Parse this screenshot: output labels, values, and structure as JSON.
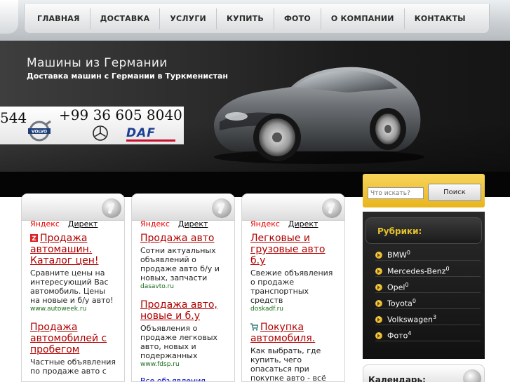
{
  "nav": {
    "items": [
      "ГЛАВНАЯ",
      "ДОСТАВКА",
      "УСЛУГИ",
      "КУПИТЬ",
      "ФОТО",
      "О КОМПАНИИ",
      "КОНТАКТЫ"
    ]
  },
  "header": {
    "title": "Машины из Германии",
    "subtitle": "Доставка машин с Германии в Туркменистан",
    "phone_left": "544",
    "phone_main": "+99 36 605 8040",
    "brand_daf": "DAF"
  },
  "columns": [
    {
      "yandex": "Яндекс",
      "direct": "Директ",
      "ads": [
        {
          "title": "Продажа автомашин. Каталог цен!",
          "text": "Сравните цены на интересующий Вас автомобиль. Цены на новые и б/у авто!",
          "url": "www.autoweek.ru"
        },
        {
          "title": "Продажа автомобилей с пробегом",
          "text": "Частные объявления по продаже авто с",
          "url": ""
        }
      ]
    },
    {
      "yandex": "Яндекс",
      "direct": "Директ",
      "ads": [
        {
          "title": "Продажа авто",
          "text": "Сотни актуальных объявлений о продаже авто б/у и новых, запчасти",
          "url": "dasavto.ru"
        },
        {
          "title": "Продажа авто, новые и б.у",
          "text": "Объявления о продаже легковых авто, новых и подержанных",
          "url": "www.fdsp.ru"
        }
      ],
      "all_link": "Все объявления"
    },
    {
      "yandex": "Яндекс",
      "direct": "Директ",
      "ads": [
        {
          "title": "Легковые и грузовые авто б.у",
          "text": "Свежие объявления о продаже транспортных средств",
          "url": "doskadf.ru"
        },
        {
          "title": "Покупка автомобиля.",
          "text": "Как выбрать, где купить, чего опасаться при покупке авто - всё",
          "url": ""
        }
      ]
    }
  ],
  "search": {
    "placeholder": "Что искать?",
    "button": "Поиск"
  },
  "rubrics": {
    "title": "Рубрики:",
    "items": [
      {
        "label": "BMW",
        "count": "0"
      },
      {
        "label": "Mercedes-Benz",
        "count": "0"
      },
      {
        "label": "Opel",
        "count": "0"
      },
      {
        "label": "Toyota",
        "count": "0"
      },
      {
        "label": "Volkswagen",
        "count": "3"
      },
      {
        "label": "Фото",
        "count": "4"
      }
    ]
  },
  "calendar": {
    "title": "Календарь:"
  },
  "colors": {
    "accent_gold": "#e9b51c",
    "ad_title_red": "#b00000",
    "ad_url_green": "#1a6c1a"
  }
}
